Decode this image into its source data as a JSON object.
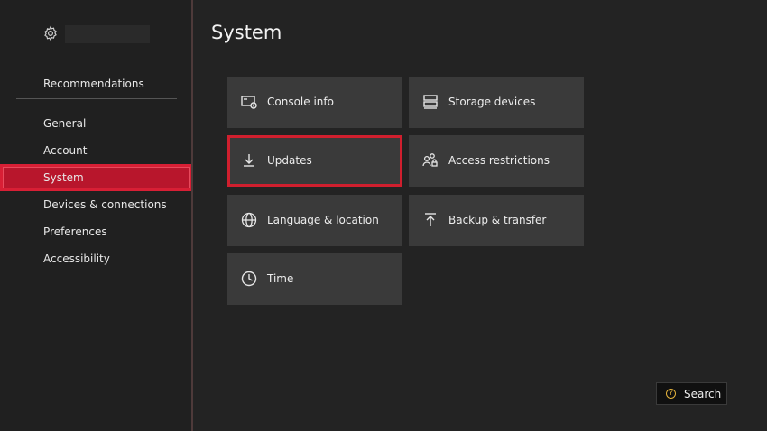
{
  "page": {
    "title": "System"
  },
  "sidebar": {
    "recommendations": "Recommendations",
    "items": [
      {
        "label": "General"
      },
      {
        "label": "Account"
      },
      {
        "label": "System",
        "selected": true
      },
      {
        "label": "Devices & connections"
      },
      {
        "label": "Preferences"
      },
      {
        "label": "Accessibility"
      }
    ]
  },
  "tiles": [
    {
      "label": "Console info",
      "icon": "console-info-icon"
    },
    {
      "label": "Storage devices",
      "icon": "storage-devices-icon"
    },
    {
      "label": "Updates",
      "icon": "download-icon",
      "focused": true
    },
    {
      "label": "Access restrictions",
      "icon": "people-lock-icon"
    },
    {
      "label": "Language & location",
      "icon": "globe-icon"
    },
    {
      "label": "Backup & transfer",
      "icon": "upload-icon"
    },
    {
      "label": "Time",
      "icon": "clock-icon"
    }
  ],
  "footer": {
    "search_button_key": "Y",
    "search_label": "Search"
  },
  "colors": {
    "accent": "#d01f2e",
    "badge_y": "#e3b23c"
  }
}
